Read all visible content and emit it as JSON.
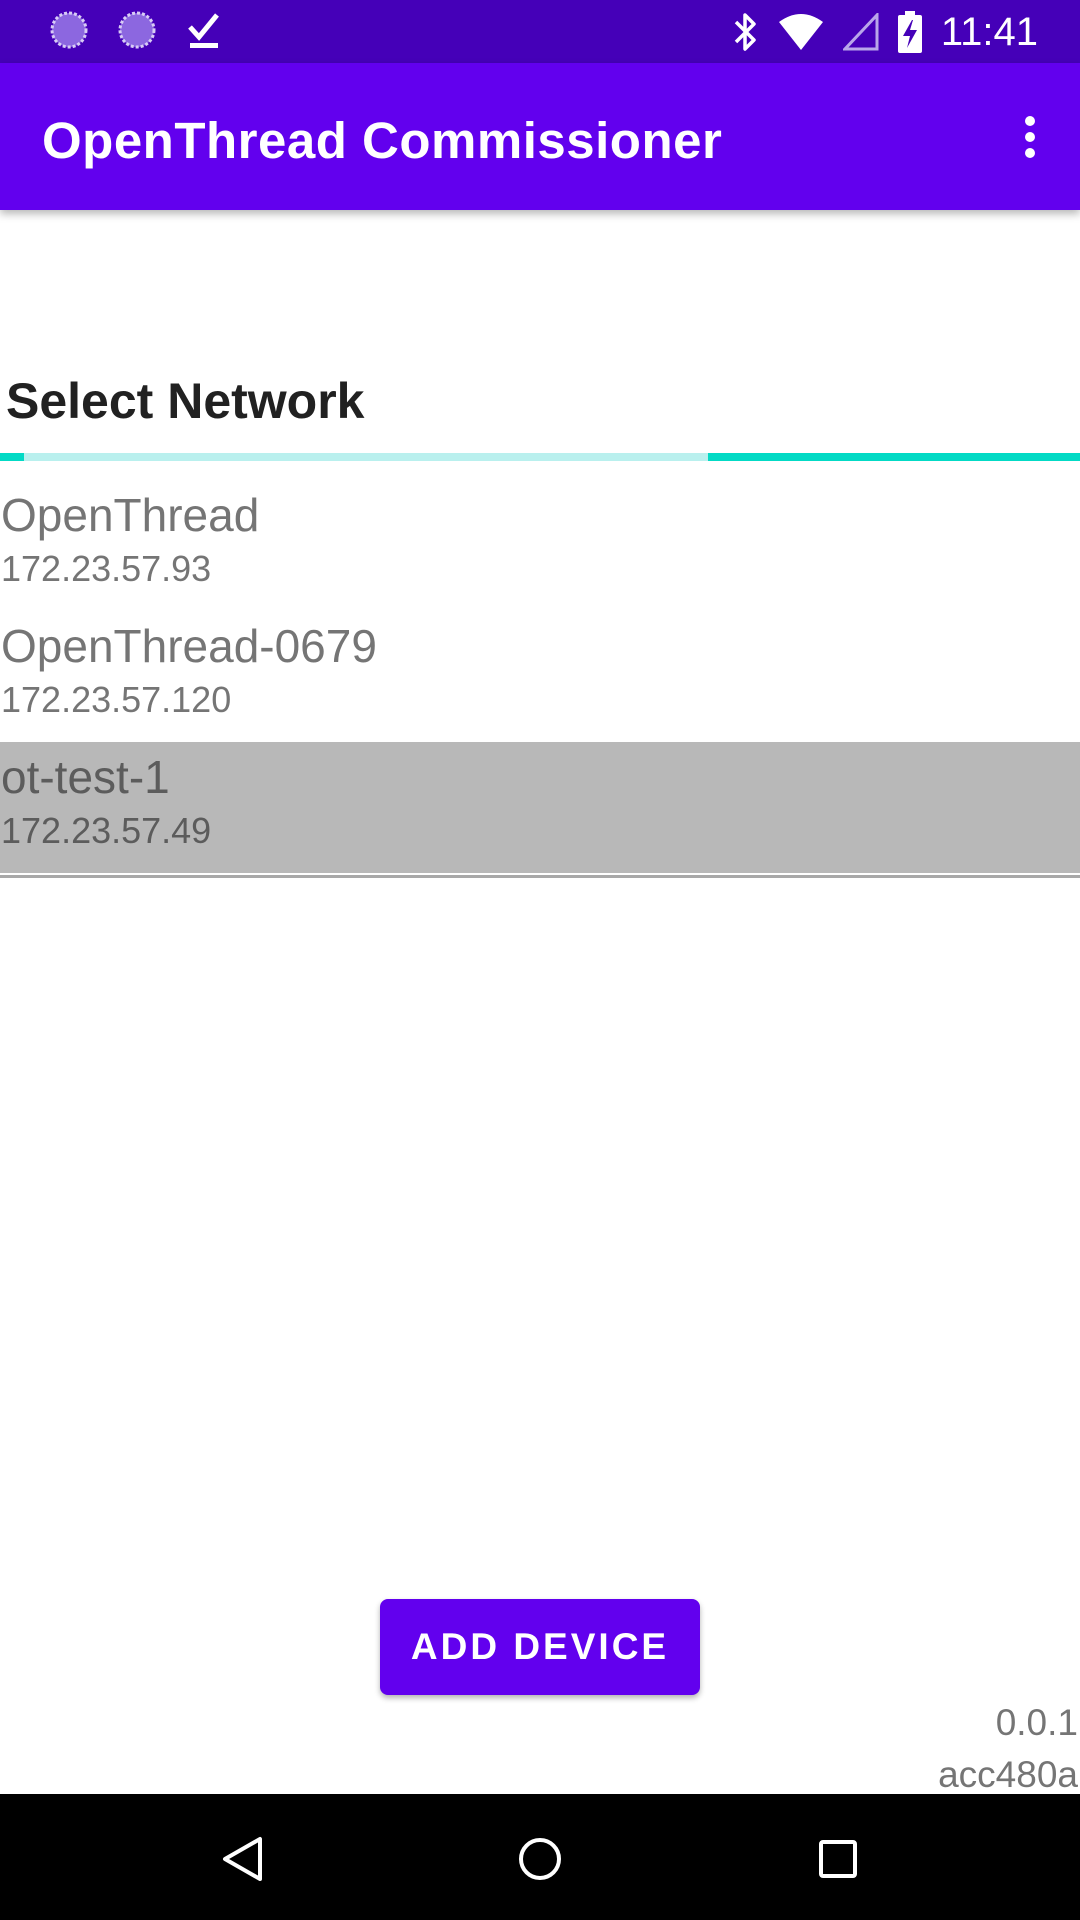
{
  "status_bar": {
    "time": "11:41",
    "left_icons": [
      "sync-icon",
      "sync-icon",
      "download-done-icon"
    ],
    "right_icons": [
      "bluetooth-icon",
      "wifi-icon",
      "cellular-signal-icon",
      "battery-charging-icon"
    ],
    "background_color": "#4500b8"
  },
  "app_bar": {
    "title": "OpenThread Commissioner",
    "overflow_icon": "more-vert-icon",
    "background_color": "#6200ee"
  },
  "main": {
    "section_title": "Select Network",
    "progress": {
      "style": "indeterminate",
      "track_color": "#b9f0ee",
      "indicator_color": "#03dac5"
    },
    "networks": [
      {
        "name": "OpenThread",
        "ip": "172.23.57.93",
        "selected": false
      },
      {
        "name": "OpenThread-0679",
        "ip": "172.23.57.120",
        "selected": false
      },
      {
        "name": "ot-test-1",
        "ip": "172.23.57.49",
        "selected": true
      }
    ],
    "add_device_label": "ADD DEVICE",
    "version": "0.0.1",
    "build": "acc480a"
  },
  "nav_bar": {
    "icons": [
      "back-icon",
      "home-icon",
      "recents-icon"
    ]
  }
}
